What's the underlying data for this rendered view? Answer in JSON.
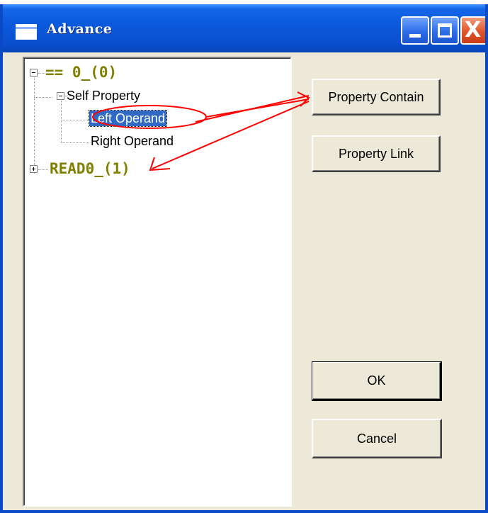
{
  "window": {
    "title": "Advance",
    "title_icon": "window-icon",
    "controls": {
      "minimize": "minimize-icon",
      "maximize": "maximize-icon",
      "close": "close-icon",
      "close_glyph": "X"
    }
  },
  "tree": {
    "items": [
      {
        "label": "== 0_(0)",
        "level": 0,
        "expanded": true,
        "style": "root"
      },
      {
        "label": "Self Property",
        "level": 1,
        "expanded": true
      },
      {
        "label": "Left Operand",
        "level": 2,
        "selected": true
      },
      {
        "label": "Right Operand",
        "level": 2
      },
      {
        "label": "READ0_(1)",
        "level": 0,
        "expanded": false,
        "style": "root"
      }
    ]
  },
  "buttons": {
    "property_contain": "Property Contain",
    "property_link": "Property Link",
    "ok": "OK",
    "cancel": "Cancel"
  },
  "colors": {
    "titlebar": "#0A50D0",
    "root_node": "#808000",
    "selection": "#316AC5",
    "annotation": "#FF0000"
  }
}
